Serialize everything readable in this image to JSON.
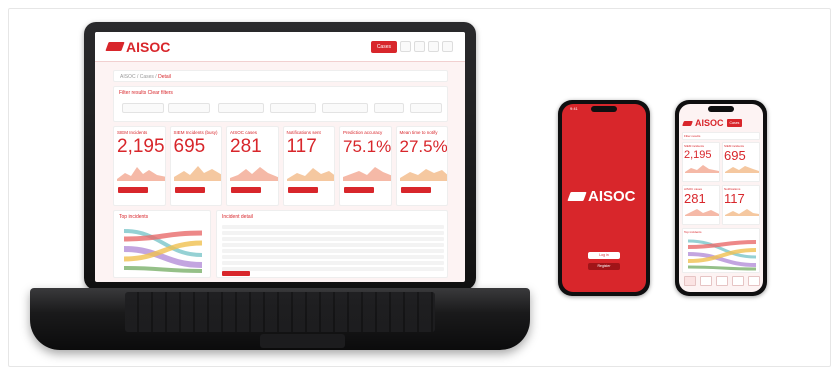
{
  "brand": {
    "name": "AISOC",
    "accent": "#d8262b"
  },
  "laptop": {
    "header": {
      "cases_label": "Cases"
    },
    "breadcrumb": {
      "path": "AISOC / Cases / ",
      "current": "Detail"
    },
    "filters": {
      "title": "Filter results   Clear filters"
    },
    "kpis": [
      {
        "title": "SIEM Incidents",
        "value": "2,195"
      },
      {
        "title": "SIEM Incidents (busy)",
        "value": "695"
      },
      {
        "title": "AISOC cases",
        "value": "281"
      },
      {
        "title": "Notifications sent",
        "value": "117"
      },
      {
        "title": "Prediction accuracy",
        "value": "75.1%"
      },
      {
        "title": "Mean time to notify",
        "value": "27.5%"
      }
    ],
    "panels": {
      "top_incidents": "Top incidents",
      "incident_detail": "Incident detail"
    }
  },
  "phone_login": {
    "time": "9:41",
    "login_label": "Log in",
    "register_label": "Register"
  },
  "phone_dashboard": {
    "cases_label": "Cases",
    "filter_label": "Filter results",
    "kpis": [
      {
        "title": "SIEM incidents",
        "value": "2,195"
      },
      {
        "title": "SIEM incidents",
        "value": "695"
      },
      {
        "title": "AISOC cases",
        "value": "281"
      },
      {
        "title": "Notifications",
        "value": "117"
      }
    ],
    "top_incidents": "Top incidents"
  },
  "icons": [
    "aisoc-logo-icon",
    "filter-icon",
    "calendar-icon",
    "chevron-down-icon",
    "menu-icon",
    "user-icon"
  ]
}
